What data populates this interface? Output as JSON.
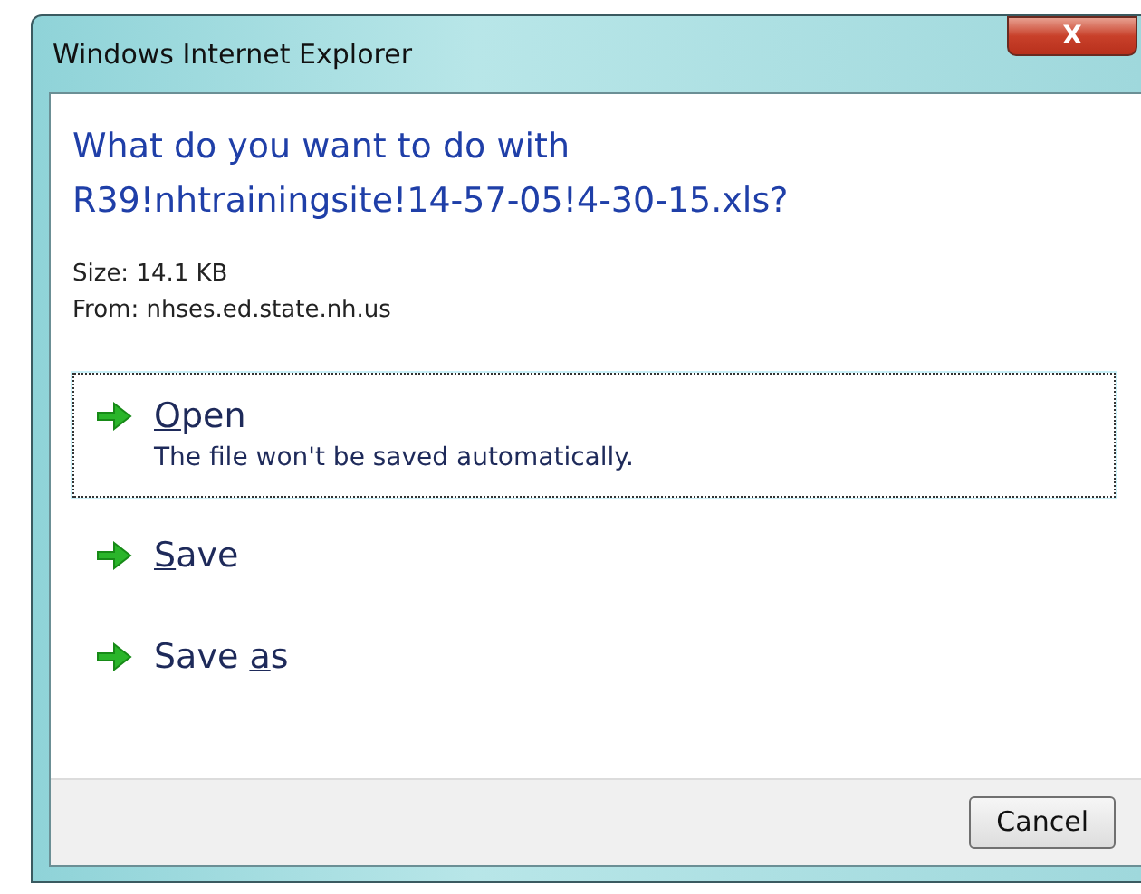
{
  "window": {
    "title": "Windows Internet Explorer",
    "close_label": "X"
  },
  "question": [
    "What do you want to do with",
    "R39!nhtrainingsite!14-57-05!4-30-15.xls?"
  ],
  "details": [
    "Size: 14.1 KB",
    "From: nhses.ed.state.nh.us"
  ],
  "options": [
    {
      "key": "O",
      "after": "pen",
      "description": "The file won't be saved automatically.",
      "selected": true
    },
    {
      "key": "S",
      "after": "ave",
      "selected": false
    },
    {
      "before": "Save ",
      "key": "a",
      "after": "s",
      "selected": false
    }
  ],
  "buttons": [
    "Cancel"
  ]
}
